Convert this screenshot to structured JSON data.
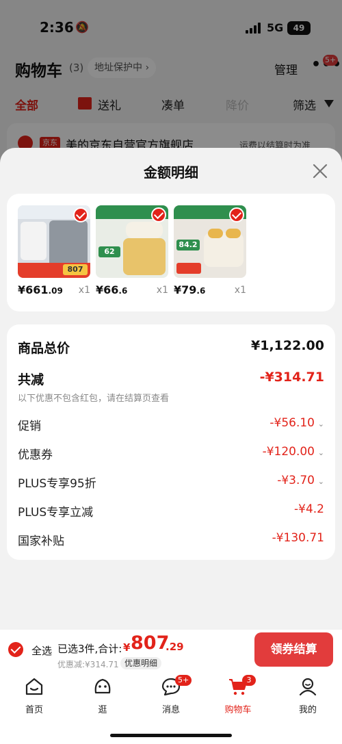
{
  "status": {
    "time": "2:36",
    "network": "5G",
    "battery": "49"
  },
  "background": {
    "title": "购物车",
    "count": "(3)",
    "address_chip": "地址保护中",
    "manage": "管理",
    "more_badge": "5+",
    "filters": [
      "全部",
      "送礼",
      "凑单",
      "降价",
      "筛选"
    ],
    "shop_tag": "京东",
    "shop_name": "美的京东自营官方旗舰店",
    "shop_note": "运费以结算时为准"
  },
  "sheet": {
    "title": "金额明细",
    "products": [
      {
        "price_int": "¥661",
        "price_dec": ".09",
        "qty": "x1",
        "img_text": "807"
      },
      {
        "price_int": "¥66",
        "price_dec": ".6",
        "qty": "x1",
        "img_text": "62"
      },
      {
        "price_int": "¥79",
        "price_dec": ".6",
        "qty": "x1",
        "img_text": "84.2"
      }
    ],
    "total_label": "商品总价",
    "total_value": "¥1,122.00",
    "reduce_label": "共减",
    "reduce_value": "-¥314.71",
    "reduce_note": "以下优惠不包含红包，请在结算页查看",
    "details": [
      {
        "label": "促销",
        "value": "-¥56.10",
        "chevron": true
      },
      {
        "label": "优惠券",
        "value": "-¥120.00",
        "chevron": true
      },
      {
        "label": "PLUS专享95折",
        "value": "-¥3.70",
        "chevron": true
      },
      {
        "label": "PLUS专享立减",
        "value": "-¥4.2",
        "chevron": false
      },
      {
        "label": "国家补贴",
        "value": "-¥130.71",
        "chevron": false
      }
    ]
  },
  "checkout": {
    "select_all": "全选",
    "summary": "已选3件,合计:",
    "currency": "¥",
    "amount_int": "807",
    "amount_dec": ".29",
    "saved": "优惠减:¥314.71",
    "detail_chip": "优惠明细",
    "button": "领券结算"
  },
  "tabs": [
    {
      "label": "首页",
      "icon": "home-icon",
      "badge": ""
    },
    {
      "label": "逛",
      "icon": "explore-icon",
      "badge": ""
    },
    {
      "label": "消息",
      "icon": "message-icon",
      "badge": "5+"
    },
    {
      "label": "购物车",
      "icon": "cart-icon",
      "badge": "3"
    },
    {
      "label": "我的",
      "icon": "profile-icon",
      "badge": ""
    }
  ],
  "colors": {
    "accent": "#e2231a",
    "button": "#e23c3c"
  }
}
